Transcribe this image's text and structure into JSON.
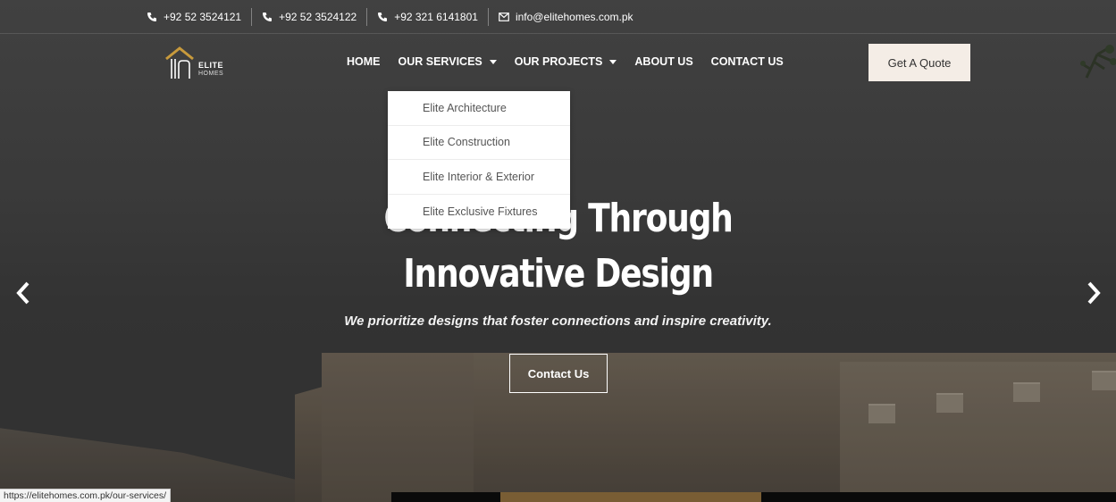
{
  "topbar": {
    "phones": [
      "+92 52 3524121",
      "+92 52 3524122",
      "+92 321 6141801"
    ],
    "email": "info@elitehomes.com.pk"
  },
  "logo": {
    "name": "ELITE",
    "sub": "HOMES"
  },
  "nav": {
    "home": "HOME",
    "services": "OUR SERVICES",
    "projects": "OUR PROJECTS",
    "about": "ABOUT US",
    "contact": "CONTACT US"
  },
  "quote_button": "Get A Quote",
  "services_dropdown": [
    "Elite Architecture",
    "Elite Construction",
    "Elite Interior & Exterior",
    "Elite Exclusive Fixtures"
  ],
  "hero": {
    "headline_line1": "Connecting Through",
    "headline_line2": "Innovative Design",
    "subline": "We prioritize designs that foster connections and inspire creativity.",
    "cta": "Contact Us"
  },
  "status_url": "https://elitehomes.com.pk/our-services/",
  "colors": {
    "quote_bg": "#f4ede6",
    "logo_gold": "#c89a3c"
  }
}
